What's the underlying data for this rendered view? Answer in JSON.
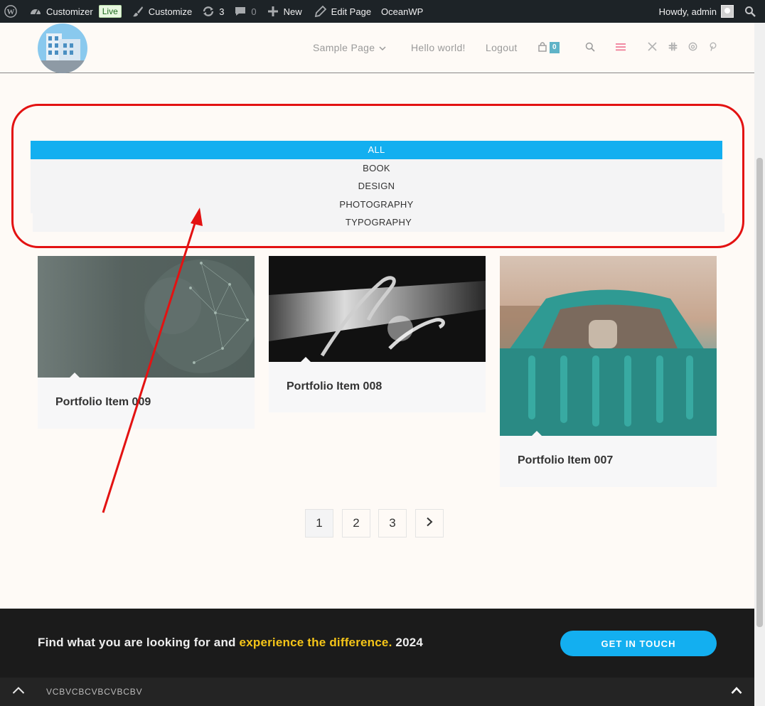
{
  "adminbar": {
    "customizer": "Customizer",
    "live": "Live",
    "customize": "Customize",
    "updates_count": "3",
    "comments_count": "0",
    "new": "New",
    "edit_page": "Edit Page",
    "site_name": "OceanWP",
    "howdy": "Howdy, admin"
  },
  "nav": {
    "items": [
      "Sample Page",
      "Hello world!",
      "Logout"
    ],
    "cart_count": "0",
    "social_icons": [
      "x-icon",
      "slack-icon",
      "threads-icon",
      "pinterest-icon"
    ]
  },
  "filters": {
    "items": [
      "ALL",
      "BOOK",
      "DESIGN",
      "PHOTOGRAPHY",
      "TYPOGRAPHY"
    ],
    "active": "ALL"
  },
  "portfolio": {
    "items": [
      {
        "title": "Portfolio Item 009"
      },
      {
        "title": "Portfolio Item 008"
      },
      {
        "title": "Portfolio Item 007"
      }
    ]
  },
  "pagination": {
    "pages": [
      "1",
      "2",
      "3"
    ],
    "current": "1",
    "next_icon": "chevron-right-icon"
  },
  "footer": {
    "text_start": "Find what you are looking for and ",
    "text_highlight": "experience the difference.",
    "text_end": " 2024",
    "cta": "GET IN TOUCH",
    "bottom_text": "VCBVCBCVBCVBCBV"
  },
  "colors": {
    "accent": "#13aff0",
    "annotation": "#e31212",
    "highlight": "#f5c518"
  }
}
